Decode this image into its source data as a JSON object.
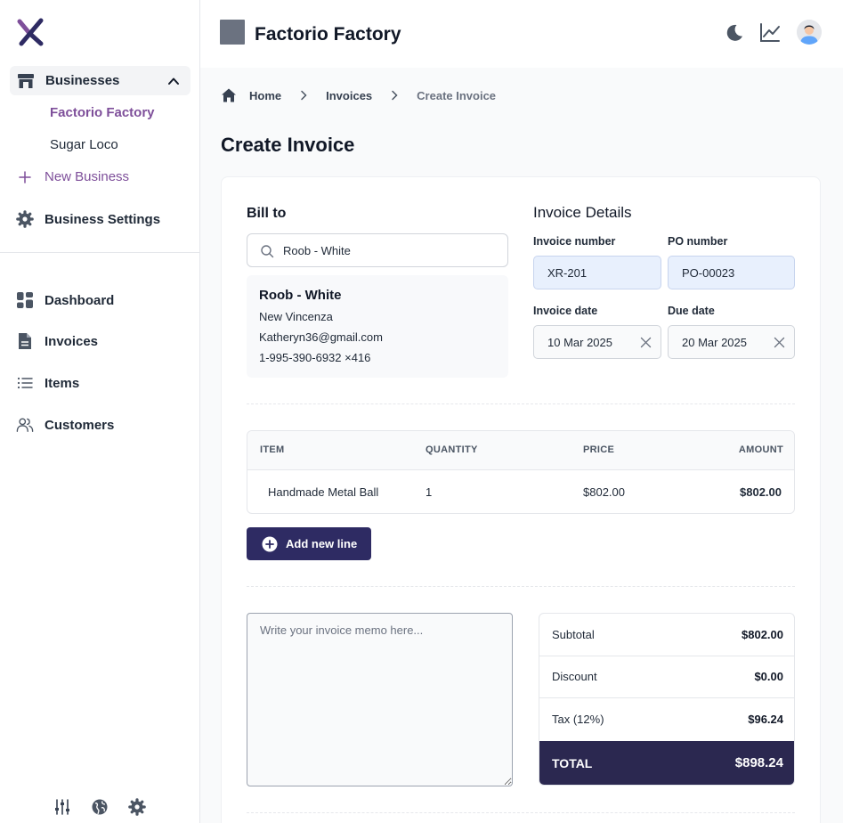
{
  "sidebar": {
    "group_label": "Businesses",
    "businesses": [
      "Factorio Factory",
      "Sugar Loco"
    ],
    "new_business": "New Business",
    "business_settings": "Business Settings",
    "nav": [
      "Dashboard",
      "Invoices",
      "Items",
      "Customers"
    ]
  },
  "header": {
    "business_name": "Factorio Factory"
  },
  "breadcrumb": {
    "home": "Home",
    "invoices": "Invoices",
    "current": "Create Invoice"
  },
  "page_title": "Create Invoice",
  "bill_to": {
    "label": "Bill to",
    "search_value": "Roob - White",
    "customer": {
      "name": "Roob - White",
      "city": "New Vincenza",
      "email": "Katheryn36@gmail.com",
      "phone": "1-995-390-6932 ×416"
    }
  },
  "details": {
    "label": "Invoice Details",
    "invoice_number_label": "Invoice number",
    "invoice_number": "XR-201",
    "po_number_label": "PO number",
    "po_number": "PO-00023",
    "invoice_date_label": "Invoice date",
    "invoice_date": "10 Mar 2025",
    "due_date_label": "Due date",
    "due_date": "20 Mar 2025"
  },
  "items_table": {
    "headers": [
      "ITEM",
      "QUANTITY",
      "PRICE",
      "AMOUNT"
    ],
    "rows": [
      {
        "item": "Handmade Metal Ball",
        "quantity": "1",
        "price": "$802.00",
        "amount": "$802.00"
      }
    ]
  },
  "add_line_label": "Add new line",
  "memo_placeholder": "Write your invoice memo here...",
  "totals": {
    "subtotal_label": "Subtotal",
    "subtotal": "$802.00",
    "discount_label": "Discount",
    "discount": "$0.00",
    "tax_label": "Tax (12%)",
    "tax": "$96.24",
    "total_label": "TOTAL",
    "total": "$898.24"
  },
  "colors": {
    "accent_purple": "#7e4f9a",
    "primary_navy": "#2e2b63",
    "total_bar": "#2b2850"
  }
}
